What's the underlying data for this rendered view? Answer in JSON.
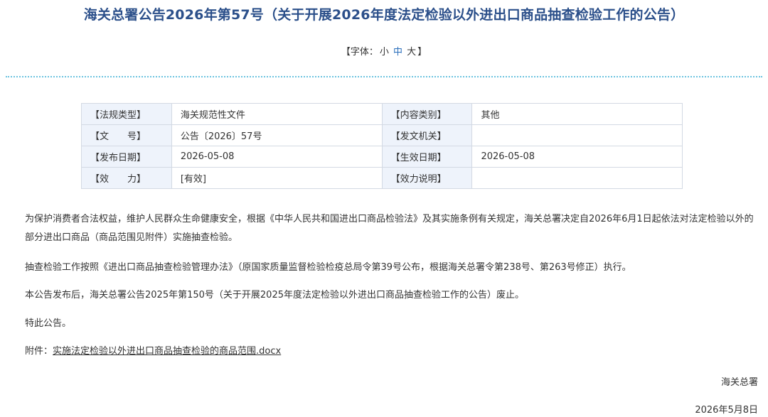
{
  "title": "海关总署公告2026年第57号（关于开展2026年度法定检验以外进出口商品抽查检验工作的公告）",
  "font_size_bar": {
    "open": "【字体：",
    "small": "小",
    "medium": "中",
    "large": "大",
    "close": "】"
  },
  "meta": {
    "type_label": "【法规类型】",
    "type_value": "海关规范性文件",
    "category_label": "【内容类别】",
    "category_value": "其他",
    "docno_label": "【文　　号】",
    "docno_value": "公告〔2026〕57号",
    "issuer_label": "【发文机关】",
    "issuer_value": "",
    "pubdate_label": "【发布日期】",
    "pubdate_value": "2026-05-08",
    "effdate_label": "【生效日期】",
    "effdate_value": "2026-05-08",
    "validity_label": "【效　　力】",
    "validity_value": "[有效]",
    "validity_note_label": "【效力说明】",
    "validity_note_value": ""
  },
  "body": {
    "p1": "为保护消费者合法权益，维护人民群众生命健康安全，根据《中华人民共和国进出口商品检验法》及其实施条例有关规定，海关总署决定自2026年6月1日起依法对法定检验以外的部分进出口商品（商品范围见附件）实施抽查检验。",
    "p2": "抽查检验工作按照《进出口商品抽查检验管理办法》（原国家质量监督检验检疫总局令第39号公布，根据海关总署令第238号、第263号修正）执行。",
    "p3": "本公告发布后，海关总署公告2025年第150号（关于开展2025年度法定检验以外进出口商品抽查检验工作的公告）废止。",
    "p4": "特此公告。",
    "attachment_label": "附件：",
    "attachment_link": "实施法定检验以外进出口商品抽查检验的商品范围.docx"
  },
  "signature": {
    "org": "海关总署",
    "date": "2026年5月8日"
  }
}
